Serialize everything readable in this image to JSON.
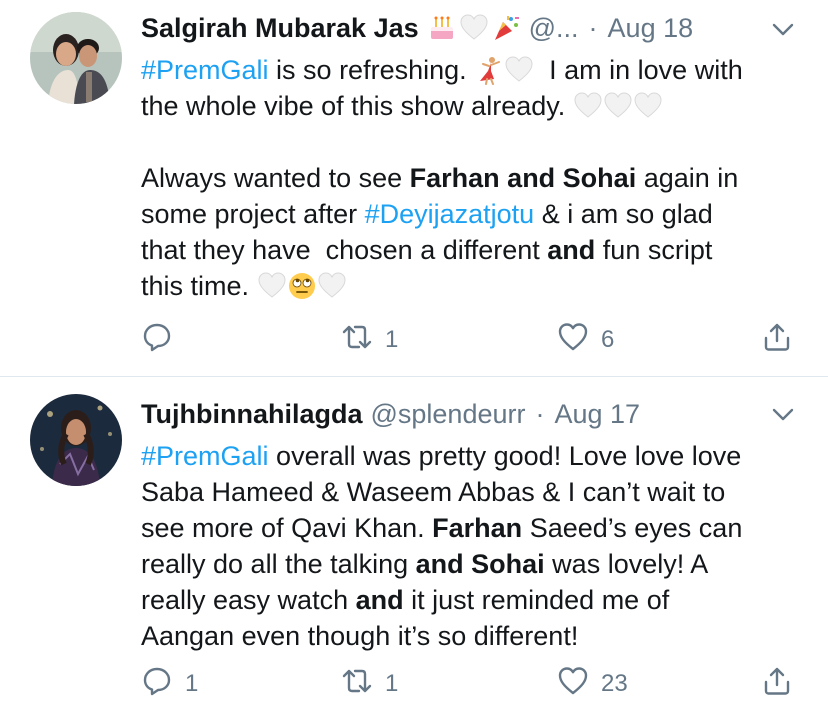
{
  "tweets": [
    {
      "author": {
        "name": "Salgirah Mubarak Jas",
        "name_emojis": [
          "cake-emoji",
          "white-heart-emoji",
          "party-popper-emoji"
        ],
        "handle": "@...",
        "date": "Aug 18"
      },
      "dot": "·",
      "lines": [
        [
          {
            "t": "hashtag",
            "v": "#PremGali"
          },
          {
            "t": "text",
            "v": " is so refreshing. "
          },
          {
            "t": "emoji",
            "v": "dancer-emoji"
          },
          {
            "t": "emoji",
            "v": "white-heart-emoji"
          },
          {
            "t": "text",
            "v": "  I am in love with"
          }
        ],
        [
          {
            "t": "text",
            "v": "the whole vibe of this show already. "
          },
          {
            "t": "emoji",
            "v": "white-heart-emoji"
          },
          {
            "t": "emoji",
            "v": "white-heart-emoji"
          },
          {
            "t": "emoji",
            "v": "white-heart-emoji"
          }
        ],
        [],
        [
          {
            "t": "text",
            "v": "Always wanted to see "
          },
          {
            "t": "bold",
            "v": "Farhan and Sohai"
          },
          {
            "t": "text",
            "v": " again in"
          }
        ],
        [
          {
            "t": "text",
            "v": "some project after "
          },
          {
            "t": "hashtag",
            "v": "#Deyijazatjotu"
          },
          {
            "t": "text",
            "v": " & i am so glad"
          }
        ],
        [
          {
            "t": "text",
            "v": "that they have  chosen a different "
          },
          {
            "t": "bold",
            "v": "and"
          },
          {
            "t": "text",
            "v": " fun script"
          }
        ],
        [
          {
            "t": "text",
            "v": "this time. "
          },
          {
            "t": "emoji",
            "v": "white-heart-emoji"
          },
          {
            "t": "emoji",
            "v": "rolling-eyes-emoji"
          },
          {
            "t": "emoji",
            "v": "white-heart-emoji"
          }
        ]
      ],
      "actions": {
        "replies": "",
        "retweets": "1",
        "likes": "6"
      }
    },
    {
      "author": {
        "name": "Tujhbinnahilagda",
        "name_emojis": [],
        "handle": "@splendeurr",
        "date": "Aug 17"
      },
      "dot": "·",
      "lines": [
        [
          {
            "t": "hashtag",
            "v": "#PremGali"
          },
          {
            "t": "text",
            "v": " overall was pretty good! Love love love"
          }
        ],
        [
          {
            "t": "text",
            "v": "Saba Hameed & Waseem Abbas & I can’t wait to"
          }
        ],
        [
          {
            "t": "text",
            "v": "see more of Qavi Khan. "
          },
          {
            "t": "bold",
            "v": "Farhan"
          },
          {
            "t": "text",
            "v": " Saeed’s eyes can"
          }
        ],
        [
          {
            "t": "text",
            "v": "really do all the talking "
          },
          {
            "t": "bold",
            "v": "and Sohai"
          },
          {
            "t": "text",
            "v": " was lovely! A"
          }
        ],
        [
          {
            "t": "text",
            "v": "really easy watch "
          },
          {
            "t": "bold",
            "v": "and"
          },
          {
            "t": "text",
            "v": " it just reminded me of"
          }
        ],
        [
          {
            "t": "text",
            "v": "Aangan even though it’s so different!"
          }
        ]
      ],
      "actions": {
        "replies": "1",
        "retweets": "1",
        "likes": "23"
      }
    }
  ],
  "colors": {
    "text": "#14171a",
    "secondary": "#657786",
    "link": "#1da1f2",
    "divider": "#e1e8ed"
  }
}
